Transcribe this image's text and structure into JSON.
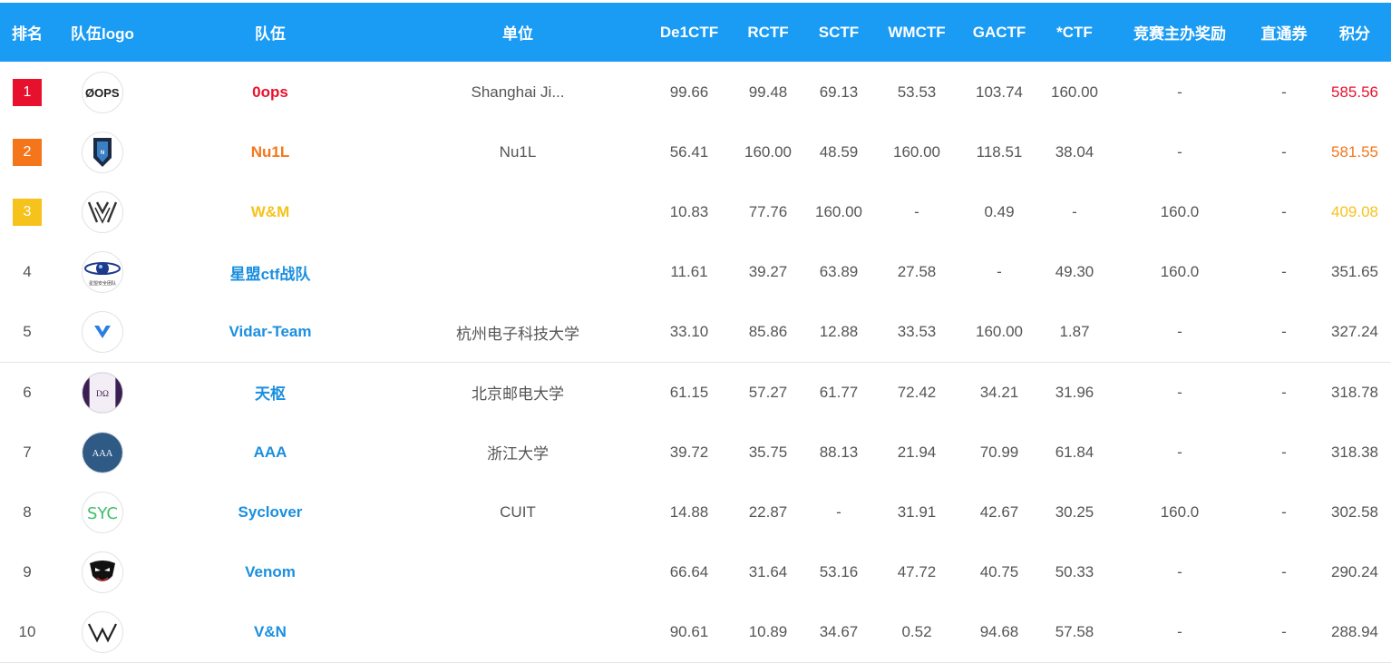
{
  "header": {
    "rank": "排名",
    "logo": "队伍logo",
    "team": "队伍",
    "unit": "单位",
    "de1ctf": "De1CTF",
    "rctf": "RCTF",
    "sctf": "SCTF",
    "wmctf": "WMCTF",
    "gactf": "GACTF",
    "starctf": "*CTF",
    "host_award": "竞赛主办奖励",
    "direct_pass": "直通券",
    "score": "积分"
  },
  "colors": {
    "header_bg": "#1a9bf4",
    "rank1": "#e8112d",
    "rank2": "#f5761a",
    "rank3": "#f6c21c",
    "team_link": "#1a8fe0"
  },
  "rows": [
    {
      "rank": "1",
      "logo_icon": "0ops-logo-icon",
      "team": "0ops",
      "unit": "Shanghai Ji...",
      "de1ctf": "99.66",
      "rctf": "99.48",
      "sctf": "69.13",
      "wmctf": "53.53",
      "gactf": "103.74",
      "starctf": "160.00",
      "host_award": "-",
      "direct_pass": "-",
      "score": "585.56"
    },
    {
      "rank": "2",
      "logo_icon": "nu1l-logo-icon",
      "team": "Nu1L",
      "unit": "Nu1L",
      "de1ctf": "56.41",
      "rctf": "160.00",
      "sctf": "48.59",
      "wmctf": "160.00",
      "gactf": "118.51",
      "starctf": "38.04",
      "host_award": "-",
      "direct_pass": "-",
      "score": "581.55"
    },
    {
      "rank": "3",
      "logo_icon": "wm-logo-icon",
      "team": "W&M",
      "unit": "",
      "de1ctf": "10.83",
      "rctf": "77.76",
      "sctf": "160.00",
      "wmctf": "-",
      "gactf": "0.49",
      "starctf": "-",
      "host_award": "160.0",
      "direct_pass": "-",
      "score": "409.08"
    },
    {
      "rank": "4",
      "logo_icon": "xingmeng-logo-icon",
      "team": "星盟ctf战队",
      "unit": "",
      "de1ctf": "11.61",
      "rctf": "39.27",
      "sctf": "63.89",
      "wmctf": "27.58",
      "gactf": "-",
      "starctf": "49.30",
      "host_award": "160.0",
      "direct_pass": "-",
      "score": "351.65"
    },
    {
      "rank": "5",
      "logo_icon": "vidar-logo-icon",
      "team": "Vidar-Team",
      "unit": "杭州电子科技大学",
      "de1ctf": "33.10",
      "rctf": "85.86",
      "sctf": "12.88",
      "wmctf": "33.53",
      "gactf": "160.00",
      "starctf": "1.87",
      "host_award": "-",
      "direct_pass": "-",
      "score": "327.24"
    },
    {
      "rank": "6",
      "logo_icon": "tianshu-logo-icon",
      "team": "天枢",
      "unit": "北京邮电大学",
      "de1ctf": "61.15",
      "rctf": "57.27",
      "sctf": "61.77",
      "wmctf": "72.42",
      "gactf": "34.21",
      "starctf": "31.96",
      "host_award": "-",
      "direct_pass": "-",
      "score": "318.78"
    },
    {
      "rank": "7",
      "logo_icon": "aaa-logo-icon",
      "team": "AAA",
      "unit": "浙江大学",
      "de1ctf": "39.72",
      "rctf": "35.75",
      "sctf": "88.13",
      "wmctf": "21.94",
      "gactf": "70.99",
      "starctf": "61.84",
      "host_award": "-",
      "direct_pass": "-",
      "score": "318.38"
    },
    {
      "rank": "8",
      "logo_icon": "syclover-logo-icon",
      "team": "Syclover",
      "unit": "CUIT",
      "de1ctf": "14.88",
      "rctf": "22.87",
      "sctf": "-",
      "wmctf": "31.91",
      "gactf": "42.67",
      "starctf": "30.25",
      "host_award": "160.0",
      "direct_pass": "-",
      "score": "302.58"
    },
    {
      "rank": "9",
      "logo_icon": "venom-logo-icon",
      "team": "Venom",
      "unit": "",
      "de1ctf": "66.64",
      "rctf": "31.64",
      "sctf": "53.16",
      "wmctf": "47.72",
      "gactf": "40.75",
      "starctf": "50.33",
      "host_award": "-",
      "direct_pass": "-",
      "score": "290.24"
    },
    {
      "rank": "10",
      "logo_icon": "vn-logo-icon",
      "team": "V&N",
      "unit": "",
      "de1ctf": "90.61",
      "rctf": "10.89",
      "sctf": "34.67",
      "wmctf": "0.52",
      "gactf": "94.68",
      "starctf": "57.58",
      "host_award": "-",
      "direct_pass": "-",
      "score": "288.94"
    }
  ]
}
